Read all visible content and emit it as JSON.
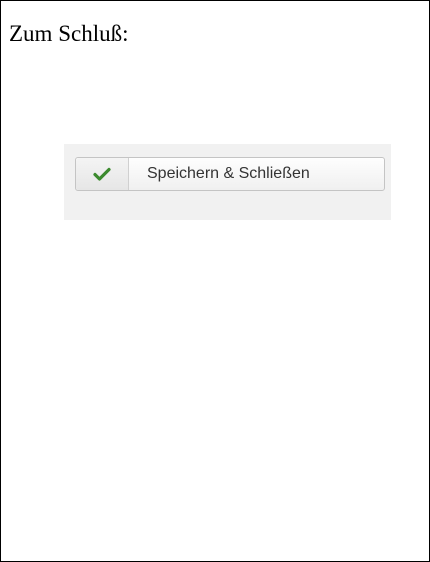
{
  "heading": "Zum Schluß:",
  "save_button": {
    "label": "Speichern & Schließen",
    "icon": "checkmark-icon",
    "icon_color": "#3b8a2e"
  }
}
